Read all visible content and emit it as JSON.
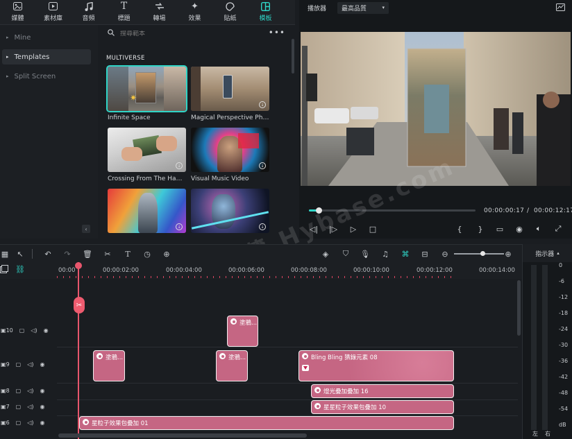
{
  "top_tabs": [
    {
      "label": "媒體",
      "icon": "media-icon"
    },
    {
      "label": "素材庫",
      "icon": "stock-icon"
    },
    {
      "label": "音頻",
      "icon": "music-note-icon"
    },
    {
      "label": "標題",
      "icon": "text-icon"
    },
    {
      "label": "轉場",
      "icon": "transition-icon"
    },
    {
      "label": "效果",
      "icon": "effects-icon"
    },
    {
      "label": "貼紙",
      "icon": "sticker-icon"
    },
    {
      "label": "模板",
      "icon": "template-icon",
      "active": true
    }
  ],
  "sidebar": {
    "items": [
      {
        "label": "Mine"
      },
      {
        "label": "Templates",
        "active": true
      },
      {
        "label": "Split Screen"
      }
    ]
  },
  "library": {
    "search_placeholder": "搜尋範本",
    "section_title": "MULTIVERSE",
    "templates": [
      {
        "label": "Infinite Space",
        "selected": true
      },
      {
        "label": "Magical Perspective Phon..."
      },
      {
        "label": "Crossing From The Hand 01"
      },
      {
        "label": "Visual Music Video"
      },
      {
        "label": ""
      },
      {
        "label": ""
      }
    ]
  },
  "player": {
    "label": "播放器",
    "quality": "最高品質",
    "current_time": "00:00:00:17",
    "separator": "/",
    "total_time": "00:00:12:17",
    "progress": 0.03
  },
  "timeline": {
    "ruler_labels": [
      "00:00",
      "00:00:02:00",
      "00:00:04:00",
      "00:00:06:00",
      "00:00:08:00",
      "00:00:10:00",
      "00:00:12:00",
      "00:00:14:00"
    ],
    "tracks": [
      {
        "num": "10"
      },
      {
        "num": "9"
      },
      {
        "num": "8"
      },
      {
        "num": "7"
      },
      {
        "num": "6"
      }
    ],
    "clips": {
      "t10_a": "塗鴉...",
      "t9_a": "塗鴉...",
      "t9_b": "塗鴉...",
      "t9_c": "Bling Bling 猜錄元素 08",
      "t8_a": "燈光疊加疊加 16",
      "t7_a": "星星粒子效果包疊加 10",
      "t6_a": "星粒子效果包疊加 01"
    }
  },
  "meter": {
    "label": "指示器",
    "scale": [
      "0",
      "-6",
      "-12",
      "-18",
      "-24",
      "-30",
      "-36",
      "-42",
      "-48",
      "-54",
      "dB"
    ],
    "left": "左",
    "right": "右"
  },
  "watermark": "記得收藏 Hybase.com",
  "colors": {
    "accent": "#2fd5c7",
    "clip": "#c56683",
    "playhead": "#e8566d"
  }
}
